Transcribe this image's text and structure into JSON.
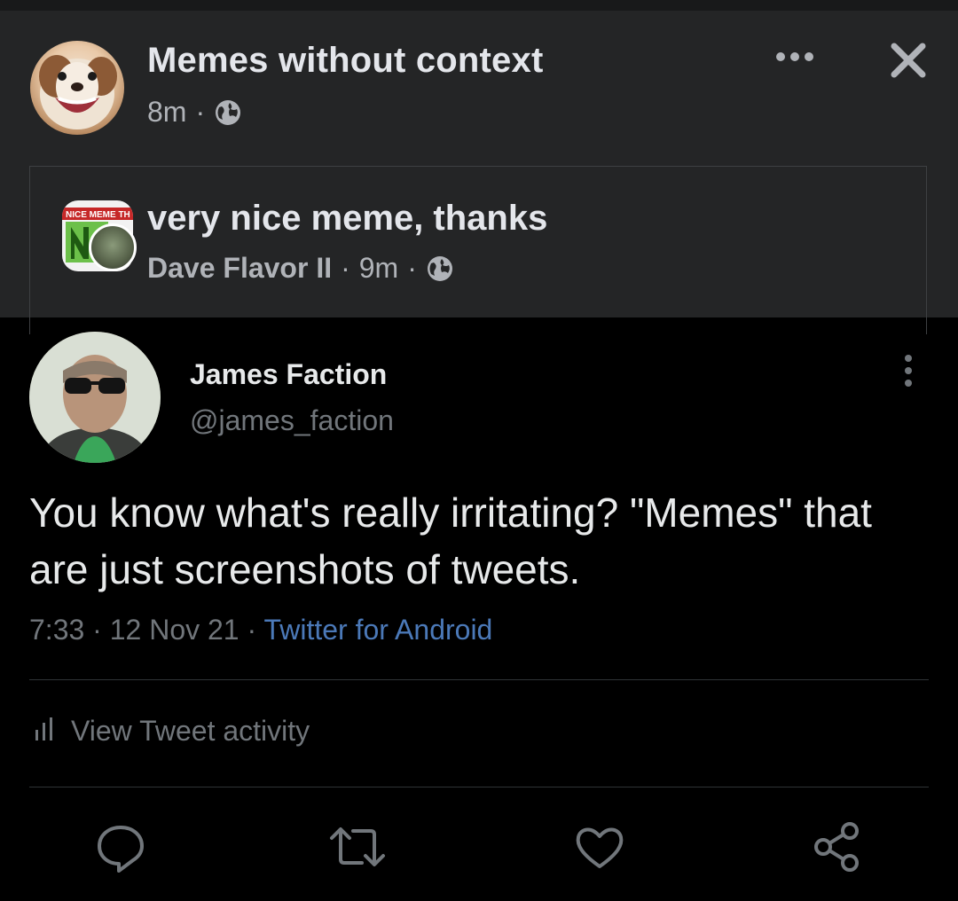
{
  "facebook_post": {
    "page_name": "Memes without context",
    "time": "8m",
    "separator": "·",
    "comment": {
      "text": "very nice meme, thanks",
      "author": "Dave Flavor II",
      "time": "9m",
      "avatar_badge_text": "NICE MEME TH"
    }
  },
  "tweet": {
    "name": "James Faction",
    "handle": "@james_faction",
    "text": "You know what's really irritating? \"Memes\" that are just screenshots of tweets.",
    "time": "7:33",
    "date": "12 Nov 21",
    "source": "Twitter for Android",
    "separator": "·",
    "activity_label": "View Tweet activity"
  },
  "icons": {
    "fb": [
      "globe-icon",
      "more-horizontal-icon",
      "close-icon"
    ],
    "tweet": [
      "more-vertical-icon",
      "bar-chart-icon",
      "reply-icon",
      "retweet-icon",
      "like-icon",
      "share-icon"
    ]
  },
  "colors": {
    "fb_background": "#242526",
    "tweet_background": "#000000",
    "link_blue": "#4b79b8",
    "muted_text": "#71767b"
  }
}
